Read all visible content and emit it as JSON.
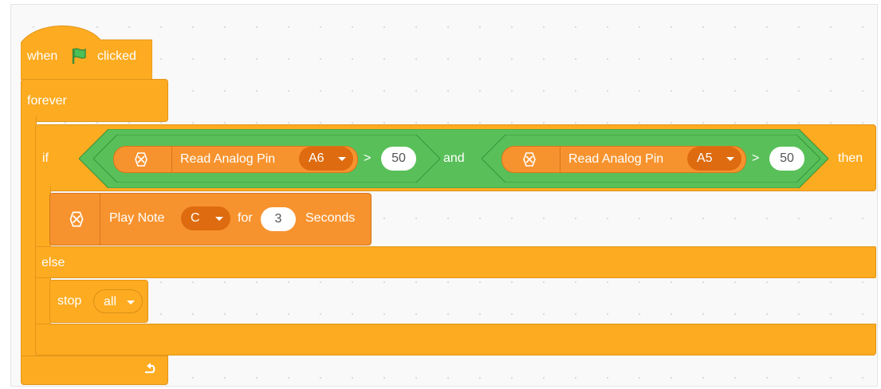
{
  "hat": {
    "when": "when",
    "clicked": "clicked",
    "flag_icon": "green-flag"
  },
  "forever": {
    "label": "forever",
    "loop_icon": "loop-arrow"
  },
  "if_block": {
    "if_label": "if",
    "then_label": "then",
    "else_label": "else",
    "and_label": "and",
    "left": {
      "label": "Read Analog Pin",
      "pin": "A6",
      "op": ">",
      "value": "50"
    },
    "right": {
      "label": "Read Analog Pin",
      "pin": "A5",
      "op": ">",
      "value": "50"
    }
  },
  "play_note": {
    "label": "Play Note",
    "note": "C",
    "for": "for",
    "duration": "3",
    "unit": "Seconds"
  },
  "stop": {
    "label": "stop",
    "option": "all"
  },
  "colors": {
    "control": "#fdab20",
    "operator": "#59c059",
    "extension": "#f7932e",
    "dropdown": "#de6b0f"
  }
}
